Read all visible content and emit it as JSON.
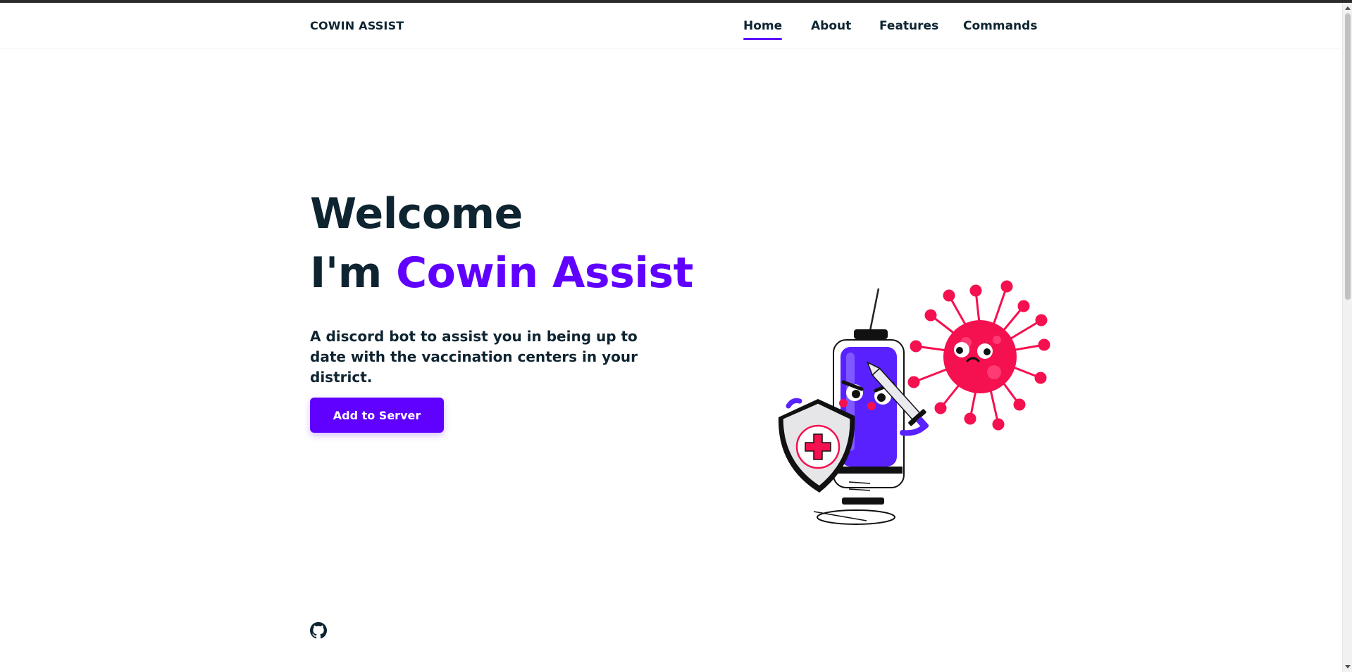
{
  "header": {
    "logo": "COWIN ASSIST",
    "nav": [
      {
        "label": "Home",
        "active": true
      },
      {
        "label": "About",
        "active": false
      },
      {
        "label": "Features",
        "active": false
      },
      {
        "label": "Commands",
        "active": false
      }
    ]
  },
  "hero": {
    "line1": "Welcome",
    "line2_prefix": "I'm ",
    "line2_accent": "Cowin Assist",
    "description": "A discord bot to assist you in being up to date with the vaccination centers in your district.",
    "cta_label": "Add to Server"
  },
  "illustration": {
    "name": "syringe-fighting-virus-illustration"
  },
  "footer": {
    "github_icon": "github-icon"
  },
  "colors": {
    "accent": "#6000ff",
    "text": "#0e2431",
    "virus": "#f5104f"
  }
}
